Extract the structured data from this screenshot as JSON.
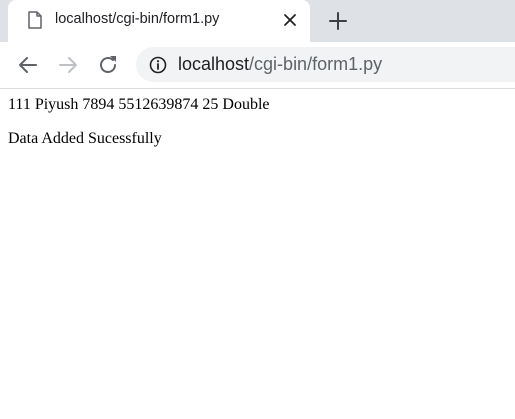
{
  "browser": {
    "tab": {
      "title": "localhost/cgi-bin/form1.py",
      "page_icon": "page-icon",
      "close_icon": "close-icon"
    },
    "new_tab_icon": "plus-icon",
    "nav": {
      "back_icon": "arrow-left-icon",
      "forward_icon": "arrow-right-icon",
      "reload_icon": "reload-icon"
    },
    "omnibox": {
      "info_icon": "info-icon",
      "url_host": "localhost",
      "url_path": "/cgi-bin/form1.py"
    },
    "colors": {
      "tabstrip_bg": "#dee1e6",
      "omnibox_bg": "#f1f3f4",
      "icon": "#5f6368",
      "icon_disabled": "#bdc1c6"
    }
  },
  "page": {
    "record_line": "111 Piyush 7894 5512639874 25 Double",
    "status_message": "Data Added Sucessfully"
  }
}
